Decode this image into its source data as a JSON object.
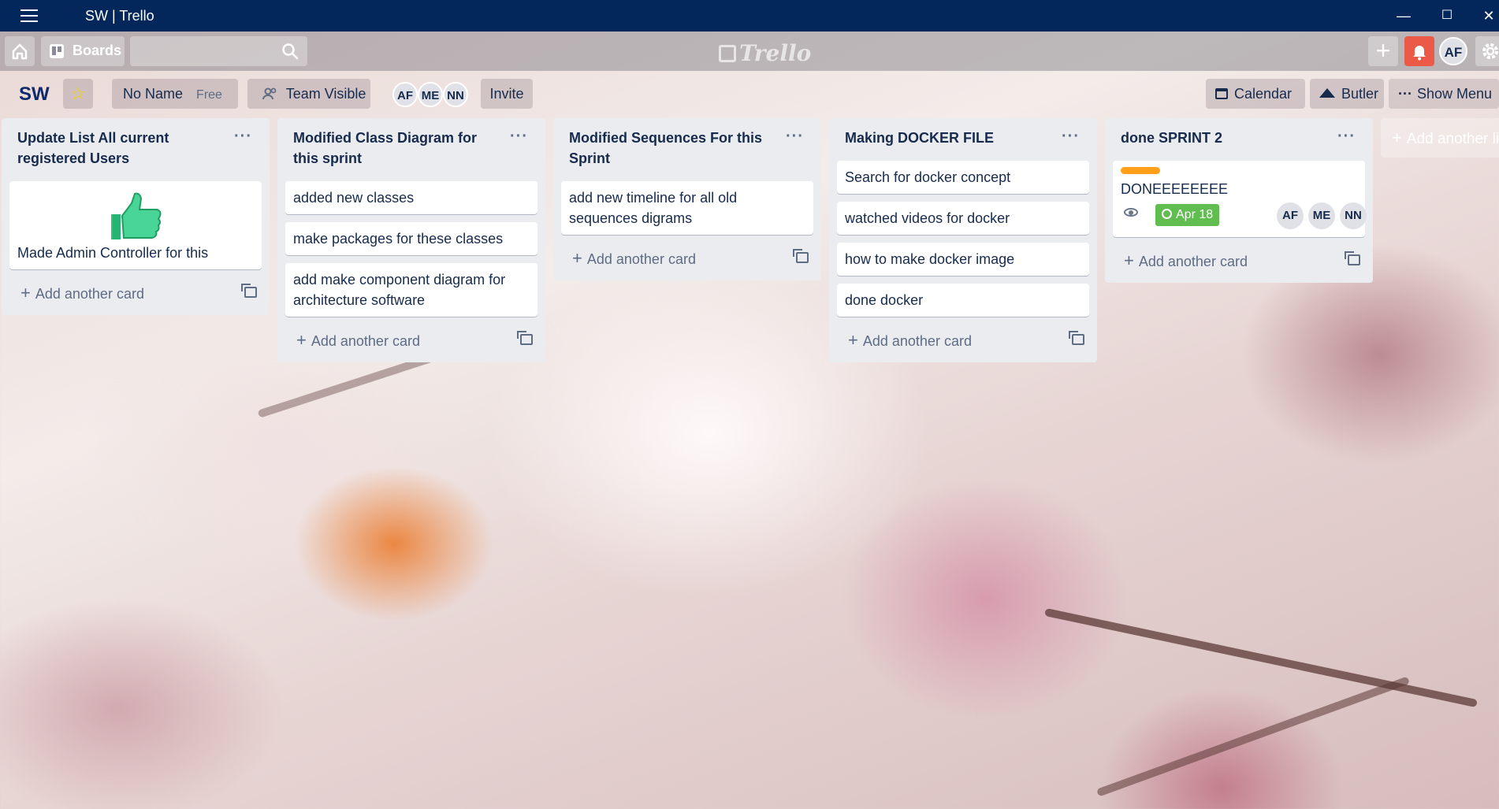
{
  "window": {
    "title": "SW | Trello"
  },
  "header": {
    "boards_label": "Boards",
    "logo_text": "Trello",
    "user_initials": "AF"
  },
  "board": {
    "name": "SW",
    "workspace": "No Name",
    "plan": "Free",
    "visibility": "Team Visible",
    "members": [
      "AF",
      "ME",
      "NN"
    ],
    "invite_label": "Invite",
    "calendar_label": "Calendar",
    "butler_label": "Butler",
    "show_menu_label": "Show Menu"
  },
  "lists": [
    {
      "title": "Update List All current registered Users",
      "cards": [
        {
          "text": "Made Admin Controller for this",
          "has_image": true
        }
      ],
      "add_label": "Add another card"
    },
    {
      "title": "Modified Class Diagram for this sprint",
      "cards": [
        {
          "text": "added new classes"
        },
        {
          "text": "make packages for these classes"
        },
        {
          "text": "add make component diagram for architecture software"
        }
      ],
      "add_label": "Add another card"
    },
    {
      "title": "Modified Sequences For this Sprint",
      "cards": [
        {
          "text": "add new timeline for all old sequences digrams"
        }
      ],
      "add_label": "Add another card"
    },
    {
      "title": "Making DOCKER FILE",
      "cards": [
        {
          "text": "Search for docker concept"
        },
        {
          "text": "watched videos for docker"
        },
        {
          "text": "how to make docker image"
        },
        {
          "text": "done docker"
        }
      ],
      "add_label": "Add another card"
    },
    {
      "title": "done SPRINT 2",
      "cards": [
        {
          "text": "DONEEEEEEEE",
          "label_color": "#ff9f1a",
          "due": "Apr 18",
          "members": [
            "AF",
            "ME",
            "NN"
          ]
        }
      ],
      "add_label": "Add another card"
    }
  ],
  "add_list_label": "Add another list",
  "colors": {
    "titlebar": "#04275b",
    "notification": "#eb5a46",
    "due_badge": "#61bd4f",
    "list_bg": "#ebecf0"
  }
}
